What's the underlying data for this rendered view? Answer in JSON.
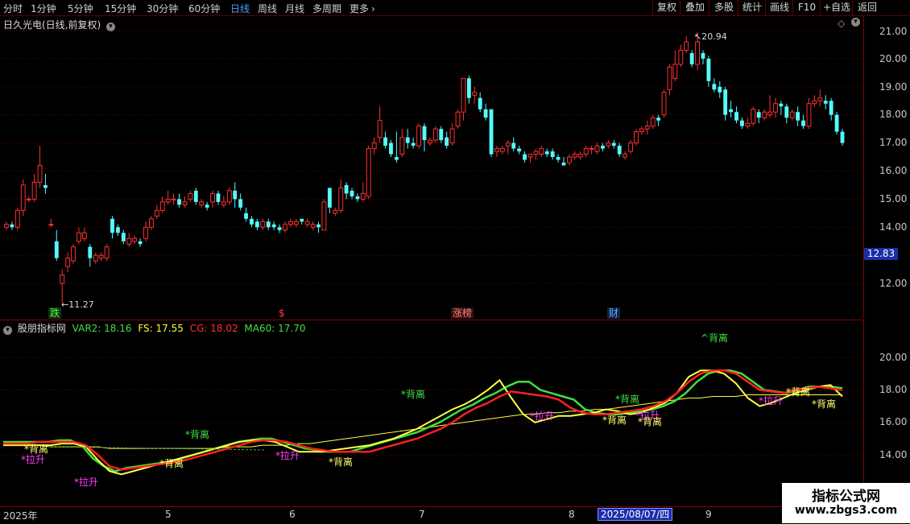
{
  "toolbar": {
    "periods": [
      "分时",
      "1分钟",
      "5分钟",
      "15分钟",
      "30分钟",
      "60分钟",
      "日线",
      "周线",
      "月线",
      "多周期",
      "更多"
    ],
    "active_period": "日线",
    "right_buttons": [
      "复权",
      "叠加",
      "多股",
      "统计",
      "画线",
      "F10",
      "+自选",
      "返回"
    ]
  },
  "main_panel": {
    "title": "日久光电(日线,前复权)",
    "price_labels": [
      "21.00",
      "20.00",
      "19.00",
      "18.00",
      "17.00",
      "16.00",
      "15.00",
      "14.00",
      "13.00",
      "12.00"
    ],
    "current_price": "12.83",
    "high_label": "20.94",
    "low_label": "11.27",
    "event_tags": [
      {
        "text": "跌",
        "color": "#4cff4c"
      },
      {
        "text": "$",
        "color": "#ff4040"
      },
      {
        "text": "涨榜",
        "color": "#ff6060"
      },
      {
        "text": "财",
        "color": "#5fa8ff"
      }
    ],
    "colors": {
      "up": "#ff3030",
      "down": "#54fcfc"
    }
  },
  "indicator_panel": {
    "name": "股朋指标网",
    "values": [
      {
        "label": "VAR2: 18.16",
        "color": "#40e040"
      },
      {
        "label": "FS: 17.55",
        "color": "#ffff40"
      },
      {
        "label": "CG: 18.02",
        "color": "#ff3030"
      },
      {
        "label": "MA60: 17.70",
        "color": "#40e040"
      }
    ],
    "axis_labels": [
      "20.00",
      "18.00",
      "16.00",
      "14.00"
    ],
    "annotations": [
      {
        "text": "*背离",
        "color": "#ffff70"
      },
      {
        "text": "*拉升",
        "color": "#ff40ff"
      },
      {
        "text": "*拉升",
        "color": "#ff40ff"
      },
      {
        "text": "*背离",
        "color": "#ffff70"
      },
      {
        "text": "*背离",
        "color": "#40e040"
      },
      {
        "text": "*拉升",
        "color": "#ff40ff"
      },
      {
        "text": "*背离",
        "color": "#ffff70"
      },
      {
        "text": "*背离",
        "color": "#40e040"
      },
      {
        "text": "*拉升",
        "color": "#ff40ff"
      },
      {
        "text": "*背离",
        "color": "#ffff70"
      },
      {
        "text": "*背离",
        "color": "#40e040"
      },
      {
        "text": "*拉升",
        "color": "#ff40ff"
      },
      {
        "text": "*背离",
        "color": "#ffff70"
      },
      {
        "text": "^背离",
        "color": "#40e040"
      },
      {
        "text": "*拉升",
        "color": "#ff40ff"
      },
      {
        "text": "*背离",
        "color": "#ffff70"
      },
      {
        "text": "*背离",
        "color": "#ffff70"
      }
    ]
  },
  "date_axis": {
    "ticks": [
      "2025年",
      "5",
      "6",
      "7",
      "8",
      "9"
    ],
    "cursor_date": "2025/08/07/四"
  },
  "watermark": {
    "title": "指标公式网",
    "url": "www.zbgs3.com"
  },
  "chart_data": {
    "type": "candlestick",
    "title": "日久光电(日线,前复权)",
    "ylim": [
      11,
      21.5
    ],
    "candles": [
      [
        14.0,
        14.1,
        13.9,
        14.2
      ],
      [
        14.1,
        14.0,
        13.9,
        14.2
      ],
      [
        14.0,
        14.6,
        13.9,
        14.7
      ],
      [
        14.6,
        15.5,
        14.4,
        15.7
      ],
      [
        15.0,
        15.0,
        14.9,
        15.1
      ],
      [
        15.0,
        15.6,
        14.9,
        15.9
      ],
      [
        15.6,
        16.2,
        15.4,
        16.9
      ],
      [
        15.5,
        15.4,
        15.2,
        15.9
      ],
      [
        14.1,
        14.1,
        14.0,
        14.3
      ],
      [
        13.5,
        12.9,
        12.8,
        13.9
      ],
      [
        12.0,
        12.3,
        11.3,
        12.5
      ],
      [
        12.6,
        12.9,
        12.4,
        13.1
      ],
      [
        12.8,
        13.3,
        12.7,
        13.4
      ],
      [
        13.5,
        13.8,
        13.4,
        14.0
      ],
      [
        13.6,
        13.8,
        13.5,
        14.0
      ],
      [
        13.3,
        12.9,
        12.6,
        13.4
      ],
      [
        12.8,
        13.0,
        12.7,
        13.1
      ],
      [
        12.9,
        13.0,
        12.8,
        13.1
      ],
      [
        12.9,
        13.3,
        12.8,
        13.4
      ],
      [
        14.3,
        13.8,
        13.6,
        14.4
      ],
      [
        14.0,
        13.8,
        13.7,
        14.1
      ],
      [
        13.8,
        13.5,
        13.4,
        13.9
      ],
      [
        13.4,
        13.6,
        13.3,
        13.8
      ],
      [
        13.5,
        13.6,
        13.4,
        13.7
      ],
      [
        13.5,
        13.4,
        13.3,
        13.6
      ],
      [
        13.6,
        14.0,
        13.5,
        14.2
      ],
      [
        14.0,
        14.3,
        13.9,
        14.4
      ],
      [
        14.4,
        14.6,
        14.3,
        14.8
      ],
      [
        14.6,
        14.9,
        14.5,
        15.1
      ],
      [
        14.9,
        15.0,
        14.8,
        15.3
      ],
      [
        15.0,
        15.0,
        14.8,
        15.2
      ],
      [
        15.0,
        14.8,
        14.7,
        15.2
      ],
      [
        14.8,
        14.9,
        14.7,
        15.1
      ],
      [
        15.0,
        15.2,
        14.9,
        15.3
      ],
      [
        15.3,
        14.9,
        14.8,
        15.4
      ],
      [
        14.8,
        14.9,
        14.7,
        15.0
      ],
      [
        14.8,
        14.7,
        14.6,
        14.9
      ],
      [
        14.9,
        15.2,
        14.7,
        15.3
      ],
      [
        15.2,
        14.9,
        14.8,
        15.3
      ],
      [
        14.8,
        14.9,
        14.7,
        15.1
      ],
      [
        14.9,
        15.3,
        14.8,
        15.4
      ],
      [
        15.3,
        15.0,
        14.7,
        15.6
      ],
      [
        15.0,
        14.7,
        14.6,
        15.2
      ],
      [
        14.5,
        14.3,
        14.2,
        14.7
      ],
      [
        14.3,
        14.1,
        14.0,
        14.4
      ],
      [
        14.2,
        14.0,
        13.9,
        14.3
      ],
      [
        14.0,
        14.2,
        13.9,
        14.3
      ],
      [
        14.2,
        14.0,
        13.9,
        14.3
      ],
      [
        14.1,
        14.0,
        13.9,
        14.2
      ],
      [
        14.0,
        13.9,
        13.8,
        14.1
      ],
      [
        13.9,
        14.1,
        13.8,
        14.2
      ],
      [
        14.1,
        14.2,
        14.0,
        14.3
      ],
      [
        14.1,
        14.2,
        14.0,
        14.3
      ],
      [
        14.3,
        14.2,
        14.1,
        14.3
      ],
      [
        14.1,
        14.2,
        14.0,
        14.3
      ],
      [
        14.0,
        14.1,
        13.9,
        14.2
      ],
      [
        14.1,
        14.0,
        13.8,
        14.2
      ],
      [
        13.9,
        14.9,
        13.9,
        15.0
      ],
      [
        15.4,
        14.7,
        14.5,
        15.4
      ],
      [
        14.5,
        14.6,
        14.4,
        14.7
      ],
      [
        14.6,
        15.4,
        14.5,
        15.7
      ],
      [
        15.5,
        15.2,
        15.0,
        15.6
      ],
      [
        15.3,
        15.1,
        15.0,
        15.4
      ],
      [
        15.1,
        15.0,
        14.9,
        15.2
      ],
      [
        15.0,
        15.2,
        14.9,
        15.6
      ],
      [
        15.1,
        16.8,
        15.0,
        16.9
      ],
      [
        16.8,
        17.0,
        16.6,
        17.2
      ],
      [
        17.2,
        17.8,
        17.0,
        18.3
      ],
      [
        17.2,
        16.9,
        16.8,
        17.4
      ],
      [
        17.0,
        16.6,
        16.5,
        17.1
      ],
      [
        16.5,
        16.4,
        16.3,
        17.4
      ],
      [
        16.6,
        17.2,
        16.5,
        17.5
      ],
      [
        17.2,
        17.0,
        16.8,
        17.5
      ],
      [
        17.0,
        16.9,
        16.8,
        17.2
      ],
      [
        16.9,
        17.6,
        16.8,
        17.7
      ],
      [
        17.6,
        17.1,
        16.7,
        17.7
      ],
      [
        17.0,
        17.1,
        16.9,
        17.2
      ],
      [
        17.1,
        17.5,
        17.0,
        17.6
      ],
      [
        17.5,
        17.1,
        17.0,
        17.6
      ],
      [
        17.2,
        16.9,
        16.8,
        17.4
      ],
      [
        17.0,
        17.5,
        16.9,
        17.7
      ],
      [
        17.6,
        18.1,
        17.5,
        18.2
      ],
      [
        18.1,
        19.3,
        17.8,
        19.3
      ],
      [
        19.3,
        18.6,
        18.4,
        19.4
      ],
      [
        18.7,
        18.8,
        18.4,
        19.0
      ],
      [
        18.6,
        18.2,
        18.1,
        18.8
      ],
      [
        18.2,
        17.9,
        17.8,
        18.4
      ],
      [
        18.2,
        16.6,
        16.5,
        18.2
      ],
      [
        16.7,
        16.8,
        16.5,
        16.9
      ],
      [
        16.7,
        16.8,
        16.6,
        16.9
      ],
      [
        16.9,
        17.0,
        16.6,
        17.1
      ],
      [
        17.0,
        16.8,
        16.7,
        17.2
      ],
      [
        16.8,
        16.7,
        16.6,
        16.9
      ],
      [
        16.6,
        16.4,
        16.3,
        16.7
      ],
      [
        16.5,
        16.6,
        16.3,
        16.6
      ],
      [
        16.6,
        16.7,
        16.4,
        16.8
      ],
      [
        16.6,
        16.8,
        16.5,
        16.9
      ],
      [
        16.7,
        16.6,
        16.5,
        16.8
      ],
      [
        16.7,
        16.5,
        16.4,
        16.8
      ],
      [
        16.5,
        16.4,
        16.3,
        16.6
      ],
      [
        16.3,
        16.2,
        16.2,
        16.5
      ],
      [
        16.3,
        16.5,
        16.2,
        16.6
      ],
      [
        16.5,
        16.6,
        16.4,
        16.7
      ],
      [
        16.5,
        16.6,
        16.4,
        16.7
      ],
      [
        16.6,
        16.8,
        16.5,
        16.9
      ],
      [
        16.8,
        16.8,
        16.6,
        16.9
      ],
      [
        16.7,
        16.9,
        16.6,
        17.0
      ],
      [
        16.9,
        16.8,
        16.7,
        17.0
      ],
      [
        16.9,
        17.0,
        16.8,
        17.1
      ],
      [
        17.0,
        16.9,
        16.8,
        17.1
      ],
      [
        16.9,
        16.6,
        16.5,
        17.0
      ],
      [
        16.5,
        16.6,
        16.4,
        16.7
      ],
      [
        16.7,
        17.0,
        16.6,
        17.1
      ],
      [
        17.0,
        17.4,
        16.9,
        17.5
      ],
      [
        17.4,
        17.5,
        17.3,
        17.6
      ],
      [
        17.5,
        17.6,
        17.3,
        17.8
      ],
      [
        17.6,
        17.9,
        17.5,
        18.0
      ],
      [
        17.9,
        17.8,
        17.6,
        18.0
      ],
      [
        18.0,
        18.8,
        17.9,
        18.9
      ],
      [
        18.9,
        19.7,
        18.7,
        19.8
      ],
      [
        19.3,
        19.8,
        19.2,
        20.3
      ],
      [
        19.8,
        20.3,
        19.7,
        20.5
      ],
      [
        20.3,
        20.6,
        20.2,
        20.8
      ],
      [
        20.2,
        19.8,
        19.7,
        20.3
      ],
      [
        19.8,
        20.6,
        19.6,
        20.94
      ],
      [
        20.2,
        20.0,
        19.8,
        20.3
      ],
      [
        20.0,
        19.2,
        19.0,
        20.1
      ],
      [
        19.1,
        18.9,
        18.8,
        19.3
      ],
      [
        19.0,
        18.8,
        18.6,
        19.2
      ],
      [
        18.9,
        18.0,
        17.8,
        19.0
      ],
      [
        18.2,
        18.1,
        17.9,
        18.5
      ],
      [
        18.1,
        17.8,
        17.7,
        18.3
      ],
      [
        17.8,
        17.6,
        17.5,
        17.9
      ],
      [
        17.6,
        17.7,
        17.5,
        17.9
      ],
      [
        17.7,
        18.2,
        17.6,
        18.3
      ],
      [
        18.1,
        17.9,
        17.7,
        18.2
      ],
      [
        17.9,
        18.1,
        17.8,
        18.2
      ],
      [
        18.0,
        18.1,
        17.9,
        18.7
      ],
      [
        18.1,
        18.4,
        17.9,
        18.6
      ],
      [
        18.4,
        18.3,
        18.0,
        18.5
      ],
      [
        18.3,
        17.9,
        17.7,
        18.4
      ],
      [
        17.9,
        18.1,
        17.8,
        18.2
      ],
      [
        18.1,
        17.8,
        17.6,
        18.3
      ],
      [
        17.8,
        17.6,
        17.5,
        18.0
      ],
      [
        17.6,
        18.4,
        17.5,
        18.6
      ],
      [
        18.4,
        18.5,
        18.3,
        18.7
      ],
      [
        18.5,
        18.6,
        18.3,
        18.9
      ],
      [
        18.5,
        18.4,
        18.2,
        18.7
      ],
      [
        18.5,
        18.0,
        17.8,
        18.6
      ],
      [
        18.0,
        17.4,
        17.3,
        18.1
      ],
      [
        17.4,
        17.0,
        16.9,
        17.5
      ]
    ],
    "indicator": {
      "VAR2": [
        14.8,
        14.8,
        14.8,
        14.8,
        14.8,
        14.9,
        14.9,
        14.6,
        13.8,
        13.3,
        13.0,
        13.2,
        13.3,
        13.4,
        13.5,
        13.6,
        13.8,
        14.0,
        14.2,
        14.4,
        14.6,
        14.8,
        14.9,
        15.0,
        15.0,
        14.8,
        14.6,
        14.4,
        14.3,
        14.2,
        14.2,
        14.2,
        14.4,
        14.6,
        14.8,
        15.0,
        15.2,
        15.4,
        15.7,
        16.0,
        16.4,
        16.8,
        17.1,
        17.5,
        17.8,
        18.2,
        18.5,
        18.5,
        18.0,
        17.8,
        17.6,
        17.4,
        16.8,
        16.6,
        16.5,
        16.5,
        16.6,
        16.7,
        16.8,
        17.0,
        17.3,
        17.8,
        18.5,
        19.0,
        19.2,
        19.2,
        19.0,
        18.5,
        18.0,
        17.9,
        17.8,
        18.0,
        18.2,
        18.2,
        18.2,
        18.1
      ],
      "FS": [
        14.6,
        14.6,
        14.6,
        14.6,
        14.6,
        14.7,
        14.7,
        14.5,
        13.7,
        13.0,
        12.8,
        13.0,
        13.2,
        13.4,
        13.6,
        13.8,
        14.0,
        14.2,
        14.4,
        14.6,
        14.8,
        14.9,
        14.9,
        14.8,
        14.5,
        14.2,
        14.2,
        14.2,
        14.3,
        14.4,
        14.5,
        14.6,
        14.8,
        15.0,
        15.3,
        15.6,
        16.0,
        16.4,
        16.8,
        17.1,
        17.5,
        18.0,
        18.6,
        17.5,
        16.5,
        16.0,
        16.2,
        16.4,
        16.4,
        16.5,
        16.6,
        16.8,
        16.7,
        16.5,
        16.6,
        16.9,
        17.2,
        17.8,
        18.8,
        19.2,
        19.2,
        19.0,
        18.4,
        17.5,
        17.0,
        17.2,
        17.5,
        17.8,
        18.0,
        18.2,
        18.3,
        17.6
      ],
      "CG": [
        14.7,
        14.7,
        14.7,
        14.8,
        14.8,
        14.8,
        14.8,
        14.6,
        14.0,
        13.3,
        13.1,
        13.2,
        13.3,
        13.4,
        13.5,
        13.6,
        13.8,
        14.0,
        14.2,
        14.4,
        14.6,
        14.8,
        14.9,
        14.9,
        14.8,
        14.6,
        14.4,
        14.3,
        14.2,
        14.2,
        14.2,
        14.2,
        14.4,
        14.6,
        14.8,
        15.0,
        15.3,
        15.6,
        16.0,
        16.5,
        16.9,
        17.2,
        17.6,
        17.9,
        17.8,
        17.7,
        17.6,
        17.4,
        16.9,
        16.6,
        16.5,
        16.5,
        16.6,
        16.7,
        16.8,
        17.0,
        17.3,
        17.8,
        18.5,
        19.0,
        19.2,
        19.2,
        19.0,
        18.5,
        18.0,
        17.9,
        17.8,
        18.0,
        18.1,
        18.2,
        18.1,
        18.0
      ],
      "MA60": [
        14.6,
        14.6,
        14.6,
        14.6,
        14.5,
        14.5,
        14.5,
        14.5,
        14.5,
        14.4,
        14.4,
        14.4,
        14.4,
        14.4,
        14.4,
        14.4,
        14.4,
        14.4,
        14.4,
        14.5,
        14.5,
        14.5,
        14.6,
        14.6,
        14.6,
        14.7,
        14.7,
        14.8,
        14.9,
        15.0,
        15.1,
        15.2,
        15.3,
        15.4,
        15.5,
        15.6,
        15.7,
        15.8,
        15.9,
        16.0,
        16.1,
        16.2,
        16.3,
        16.4,
        16.5,
        16.5,
        16.6,
        16.6,
        16.7,
        16.7,
        16.8,
        16.8,
        16.9,
        17.0,
        17.1,
        17.2,
        17.3,
        17.4,
        17.5,
        17.5,
        17.6,
        17.6,
        17.6,
        17.7,
        17.7,
        17.7,
        17.7,
        17.7,
        17.7,
        17.7,
        17.7,
        17.7
      ]
    },
    "x_ticks": [
      "2025年",
      "5",
      "6",
      "7",
      "8",
      "9"
    ]
  }
}
